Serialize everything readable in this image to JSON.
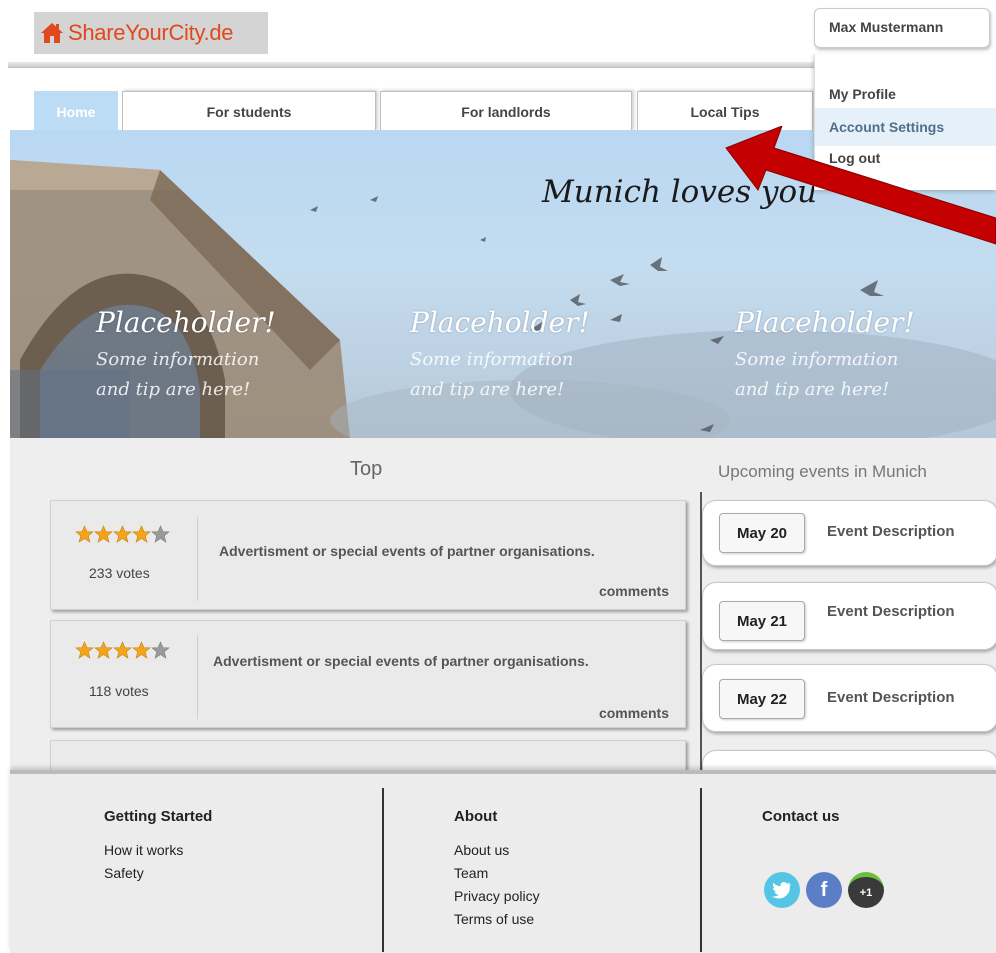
{
  "header": {
    "logo_text": "ShareYourCity.de",
    "user_name": "Max Mustermann",
    "user_menu": [
      "My Profile",
      "Account Settings",
      "Log out"
    ]
  },
  "tabs": [
    "Home",
    "For students",
    "For landlords",
    "Local Tips"
  ],
  "hero": {
    "title": "Munich loves you",
    "placeholders": [
      {
        "title": "Placeholder!",
        "line1": "Some information",
        "line2": "and tip are here!"
      },
      {
        "title": "Placeholder!",
        "line1": "Some information",
        "line2": "and tip are here!"
      },
      {
        "title": "Placeholder!",
        "line1": "Some information",
        "line2": "and tip are here!"
      }
    ]
  },
  "top": {
    "title": "Top",
    "cards": [
      {
        "rating": 4,
        "votes": "233 votes",
        "text": "Advertisment or special events of partner organisations.",
        "comments": "comments"
      },
      {
        "rating": 4,
        "votes": "118 votes",
        "text": "Advertisment or special events of partner organisations.",
        "comments": "comments"
      }
    ]
  },
  "events": {
    "title": "Upcoming events in Munich",
    "items": [
      {
        "date": "May 20",
        "desc": "Event Description"
      },
      {
        "date": "May 21",
        "desc": "Event Description"
      },
      {
        "date": "May 22",
        "desc": "Event Description"
      }
    ]
  },
  "footer": {
    "getting_started": {
      "title": "Getting Started",
      "links": [
        "How it works",
        "Safety"
      ]
    },
    "about": {
      "title": "About",
      "links": [
        "About us",
        "Team",
        "Privacy policy",
        "Terms of use"
      ]
    },
    "contact": {
      "title": "Contact us"
    },
    "social": [
      {
        "name": "twitter",
        "color": "#55c5e6"
      },
      {
        "name": "facebook",
        "color": "#5b7fc6",
        "glyph": "f"
      },
      {
        "name": "google-plus",
        "color": "#3a3a3a",
        "glyph": "+1"
      }
    ]
  },
  "colors": {
    "accent_logo": "#e0481d",
    "tab_active": "#bcdcf5",
    "arrow": "#c00000"
  }
}
